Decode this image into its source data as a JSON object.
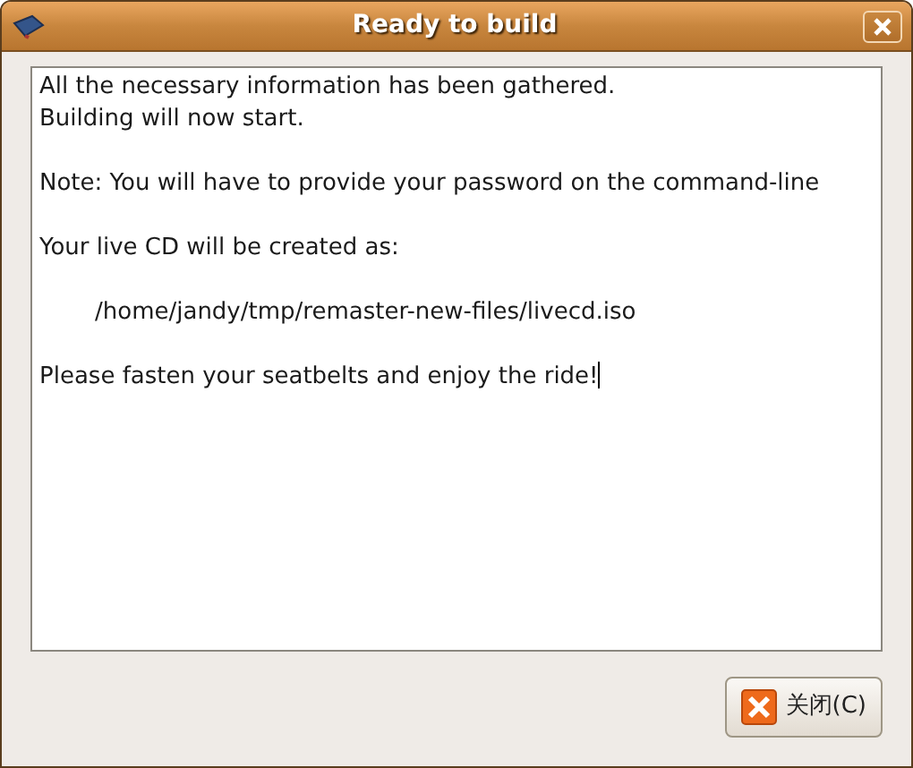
{
  "window": {
    "title": "Ready to build"
  },
  "text_area": {
    "paragraphs": [
      {
        "lines": [
          "All the necessary information has been gathered.",
          "Building will now start."
        ],
        "indented": false
      },
      {
        "lines": [
          "Note: You will have to provide your password on the command-line"
        ],
        "indented": false
      },
      {
        "lines": [
          "Your live CD will be created as:"
        ],
        "indented": false
      },
      {
        "lines": [
          "/home/jandy/tmp/remaster-new-files/livecd.iso"
        ],
        "indented": true
      },
      {
        "lines": [
          "Please fasten your seatbelts and enjoy the ride!"
        ],
        "indented": false
      }
    ]
  },
  "buttons": [
    {
      "label": "关闭(C)"
    }
  ]
}
